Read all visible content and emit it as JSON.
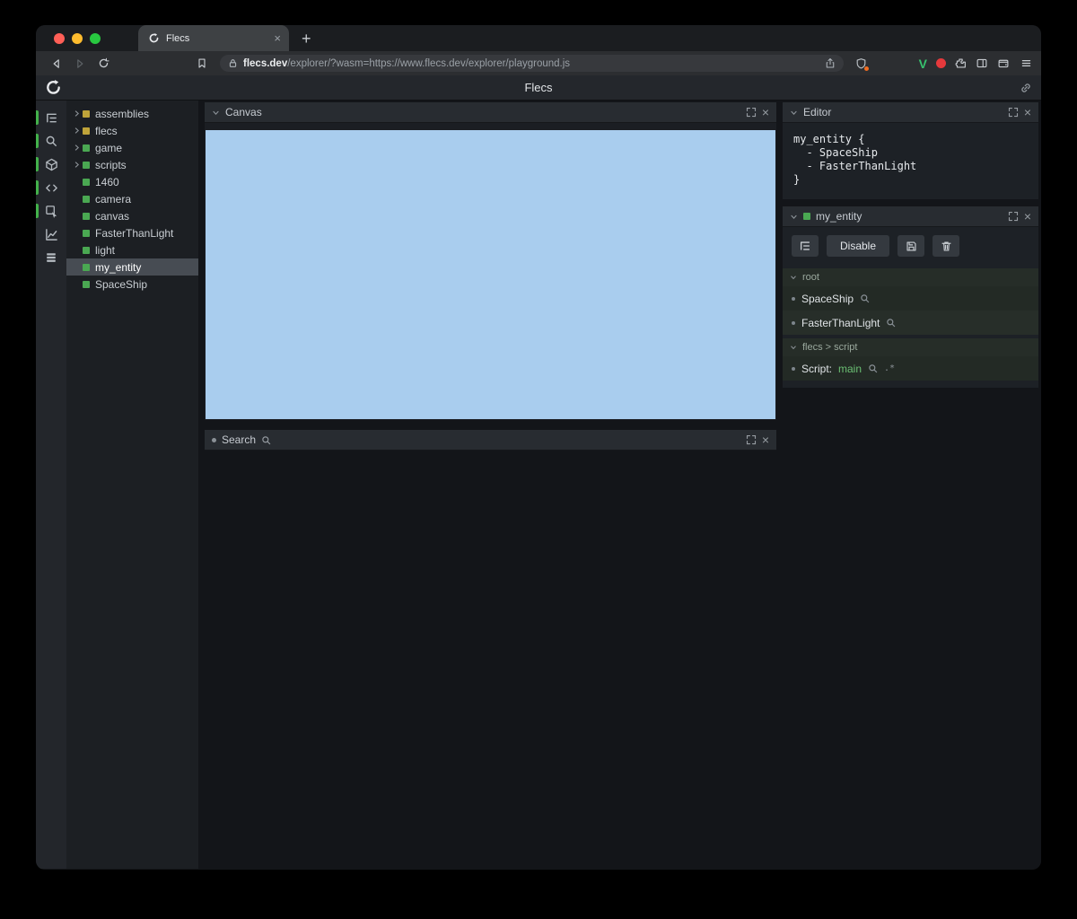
{
  "browser": {
    "tab_title": "Flecs",
    "url": {
      "host": "flecs.dev",
      "path": "/explorer/?wasm=https://www.flecs.dev/explorer/playground.js"
    }
  },
  "icons": {
    "close": "×",
    "new_tab": "+",
    "extension_v": "V",
    "script_eval": ".*"
  },
  "app": {
    "title": "Flecs"
  },
  "tree": {
    "items": [
      {
        "label": "assemblies",
        "color": "#bfa43a",
        "expandable": true,
        "selected": false
      },
      {
        "label": "flecs",
        "color": "#bfa43a",
        "expandable": true,
        "selected": false
      },
      {
        "label": "game",
        "color": "#4aa852",
        "expandable": true,
        "selected": false
      },
      {
        "label": "scripts",
        "color": "#4aa852",
        "expandable": true,
        "selected": false
      },
      {
        "label": "1460",
        "color": "#4aa852",
        "expandable": false,
        "selected": false
      },
      {
        "label": "camera",
        "color": "#4aa852",
        "expandable": false,
        "selected": false
      },
      {
        "label": "canvas",
        "color": "#4aa852",
        "expandable": false,
        "selected": false
      },
      {
        "label": "FasterThanLight",
        "color": "#4aa852",
        "expandable": false,
        "selected": false
      },
      {
        "label": "light",
        "color": "#4aa852",
        "expandable": false,
        "selected": false
      },
      {
        "label": "my_entity",
        "color": "#4aa852",
        "expandable": false,
        "selected": true
      },
      {
        "label": "SpaceShip",
        "color": "#4aa852",
        "expandable": false,
        "selected": false
      }
    ]
  },
  "panels": {
    "canvas": {
      "title": "Canvas"
    },
    "search": {
      "title": "Search"
    },
    "editor": {
      "title": "Editor",
      "code": [
        "my_entity {",
        "  - SpaceShip",
        "  - FasterThanLight",
        "}"
      ]
    },
    "entity": {
      "title": "my_entity",
      "disable_button": "Disable",
      "sections": {
        "root": {
          "title": "root",
          "items": [
            {
              "label": "SpaceShip"
            },
            {
              "label": "FasterThanLight"
            }
          ]
        },
        "script": {
          "title": "flecs > script",
          "item_prefix": "Script:",
          "item_value": "main"
        }
      }
    }
  },
  "colors": {
    "accent_green": "#4aa852",
    "module_yellow": "#bfa43a",
    "canvas_blue": "#a9cdee",
    "rail_indicator_green": "#43b14b",
    "traffic_red": "#ff5f57",
    "traffic_yellow": "#febc2e",
    "traffic_green": "#28c840"
  }
}
